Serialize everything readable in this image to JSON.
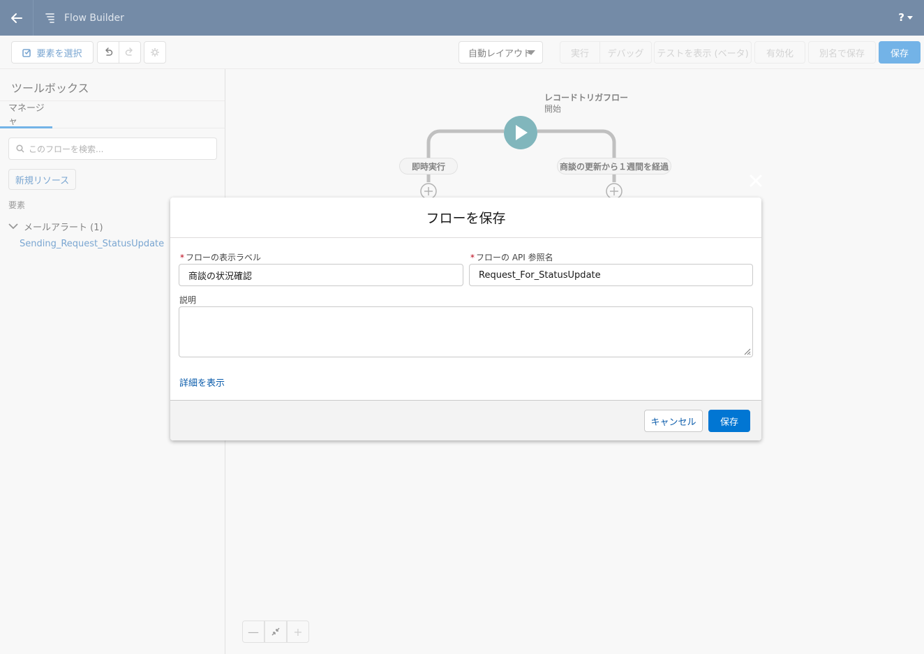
{
  "header": {
    "app_title": "Flow Builder",
    "help_label": "?"
  },
  "toolbar": {
    "select_elements": "要素を選択",
    "layout_value": "自動レイアウト",
    "run": "実行",
    "debug": "デバッグ",
    "view_tests": "テストを表示 (ベータ)",
    "activate": "有効化",
    "save_as": "別名で保存",
    "save": "保存"
  },
  "sidebar": {
    "title": "ツールボックス",
    "tab": "マネージャ",
    "search_placeholder": "このフローを検索...",
    "new_resource": "新規リソース",
    "section_label": "要素",
    "group_label": "メールアラート (1)",
    "item_label": "Sending_Request_StatusUpdate"
  },
  "canvas": {
    "start_title": "レコードトリガフロー",
    "start_sub": "開始",
    "path_left": "即時実行",
    "path_right": "商談の更新から１週間を経過"
  },
  "modal": {
    "title": "フローを保存",
    "label_field_label": "フローの表示ラベル",
    "label_field_value": "商談の状況確認",
    "api_field_label": "フローの API 参照名",
    "api_field_value": "Request_For_StatusUpdate",
    "description_label": "説明",
    "description_value": "",
    "details_link": "詳細を表示",
    "cancel": "キャンセル",
    "save": "保存",
    "required_marker": "*"
  },
  "colors": {
    "header_bg": "#032d60",
    "brand": "#0176d3",
    "start_node": "#1b7a86",
    "link": "#0b5cab",
    "required": "#ba0517"
  }
}
